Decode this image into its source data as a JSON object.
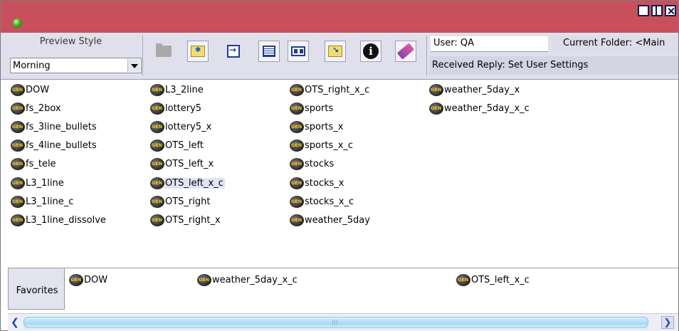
{
  "titlebar": {
    "icons": [
      "app-icon",
      "minimize-icon",
      "maximize-icon",
      "close-icon"
    ]
  },
  "preview": {
    "label": "Preview Style",
    "selected": "Morning"
  },
  "toolbar": {
    "buttons": [
      "folder-icon",
      "new-folder-icon",
      "import-icon",
      "list-view-icon",
      "thumbnail-view-icon",
      "export-icon",
      "info-icon",
      "eraser-icon"
    ]
  },
  "status": {
    "user": "User: QA",
    "folder": "Current Folder: <Main",
    "message": "Received Reply: Set User Settings"
  },
  "items": [
    "DOW",
    "fs_2box",
    "fs_3line_bullets",
    "fs_4line_bullets",
    "fs_tele",
    "L3_1line",
    "L3_1line_c",
    "L3_1line_dissolve",
    "L3_2line",
    "lottery5",
    "lottery5_x",
    "OTS_left",
    "OTS_left_x",
    "OTS_left_x_c",
    "OTS_right",
    "OTS_right_x",
    "OTS_right_x_c",
    "sports",
    "sports_x",
    "sports_x_c",
    "stocks",
    "stocks_x",
    "stocks_x_c",
    "weather_5day",
    "weather_5day_x",
    "weather_5day_x_c"
  ],
  "selected_item": "OTS_left_x_c",
  "favorites": {
    "label": "Favorites",
    "items": [
      "DOW",
      "weather_5day_x_c",
      "OTS_left_x_c"
    ]
  },
  "colors": {
    "titlebar": "#c8505c",
    "panel": "#dfe0ec",
    "selection": "#e2e3f6"
  }
}
